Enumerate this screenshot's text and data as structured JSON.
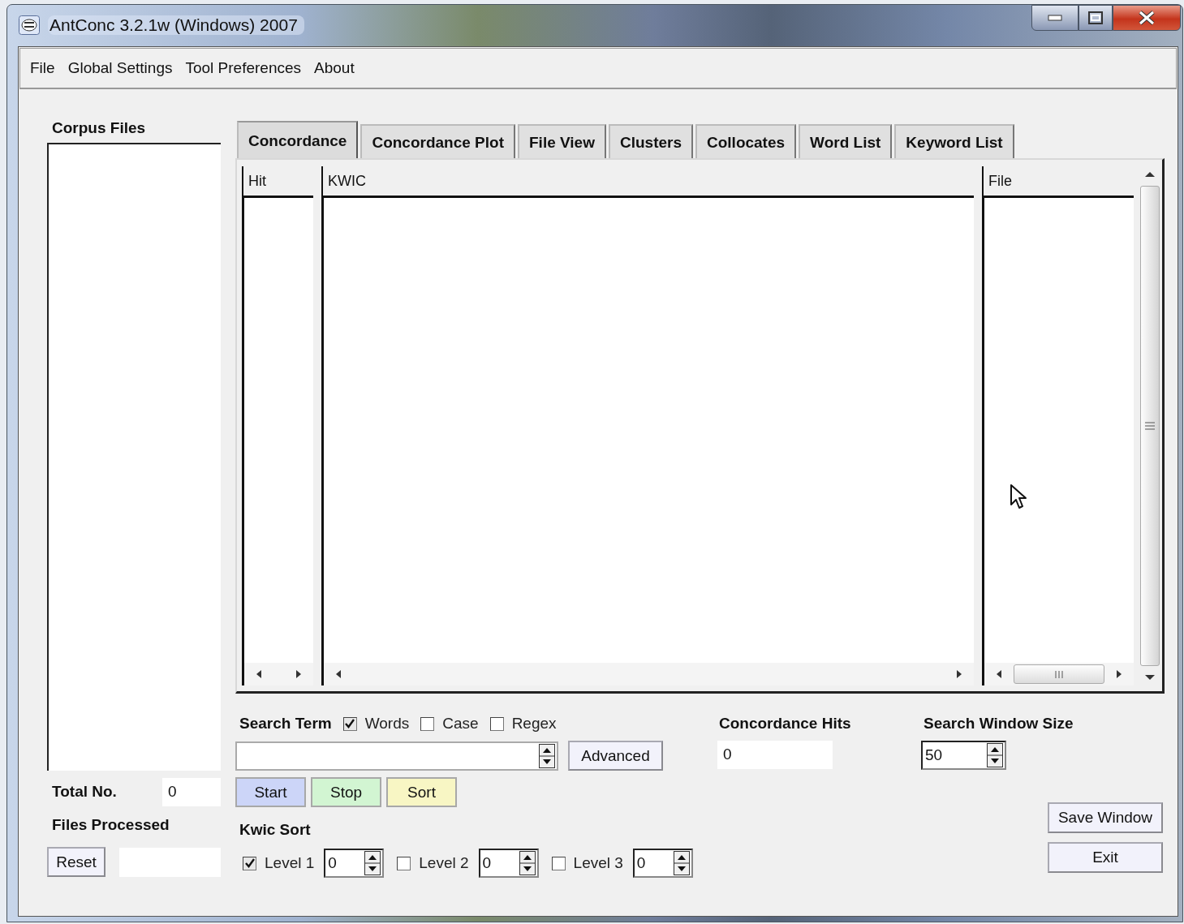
{
  "window": {
    "title": "AntConc 3.2.1w (Windows) 2007"
  },
  "menu": [
    "File",
    "Global Settings",
    "Tool Preferences",
    "About"
  ],
  "corpus": {
    "label": "Corpus Files",
    "total_label": "Total No.",
    "total_value": "0",
    "processed_label": "Files Processed",
    "reset_button": "Reset"
  },
  "tabs": [
    {
      "label": "Concordance",
      "selected": true
    },
    {
      "label": "Concordance Plot",
      "selected": false
    },
    {
      "label": "File View",
      "selected": false
    },
    {
      "label": "Clusters",
      "selected": false
    },
    {
      "label": "Collocates",
      "selected": false
    },
    {
      "label": "Word List",
      "selected": false
    },
    {
      "label": "Keyword List",
      "selected": false
    }
  ],
  "columns": [
    {
      "label": "Hit"
    },
    {
      "label": "KWIC"
    },
    {
      "label": "File"
    }
  ],
  "search": {
    "label": "Search Term",
    "options": [
      {
        "label": "Words",
        "checked": true
      },
      {
        "label": "Case",
        "checked": false
      },
      {
        "label": "Regex",
        "checked": false
      }
    ],
    "advanced_button": "Advanced"
  },
  "actions": [
    {
      "label": "Start",
      "color": "#ccd5f8"
    },
    {
      "label": "Stop",
      "color": "#d2f5d2"
    },
    {
      "label": "Sort",
      "color": "#f8f6c4"
    }
  ],
  "hits": {
    "label": "Concordance Hits",
    "value": "0"
  },
  "window_size": {
    "label": "Search Window Size",
    "value": "50"
  },
  "kwic_sort": {
    "label": "Kwic Sort",
    "levels": [
      {
        "label": "Level 1",
        "checked": true,
        "value": "0"
      },
      {
        "label": "Level 2",
        "checked": false,
        "value": "0"
      },
      {
        "label": "Level 3",
        "checked": false,
        "value": "0"
      }
    ]
  },
  "save_button": "Save Window",
  "exit_button": "Exit"
}
